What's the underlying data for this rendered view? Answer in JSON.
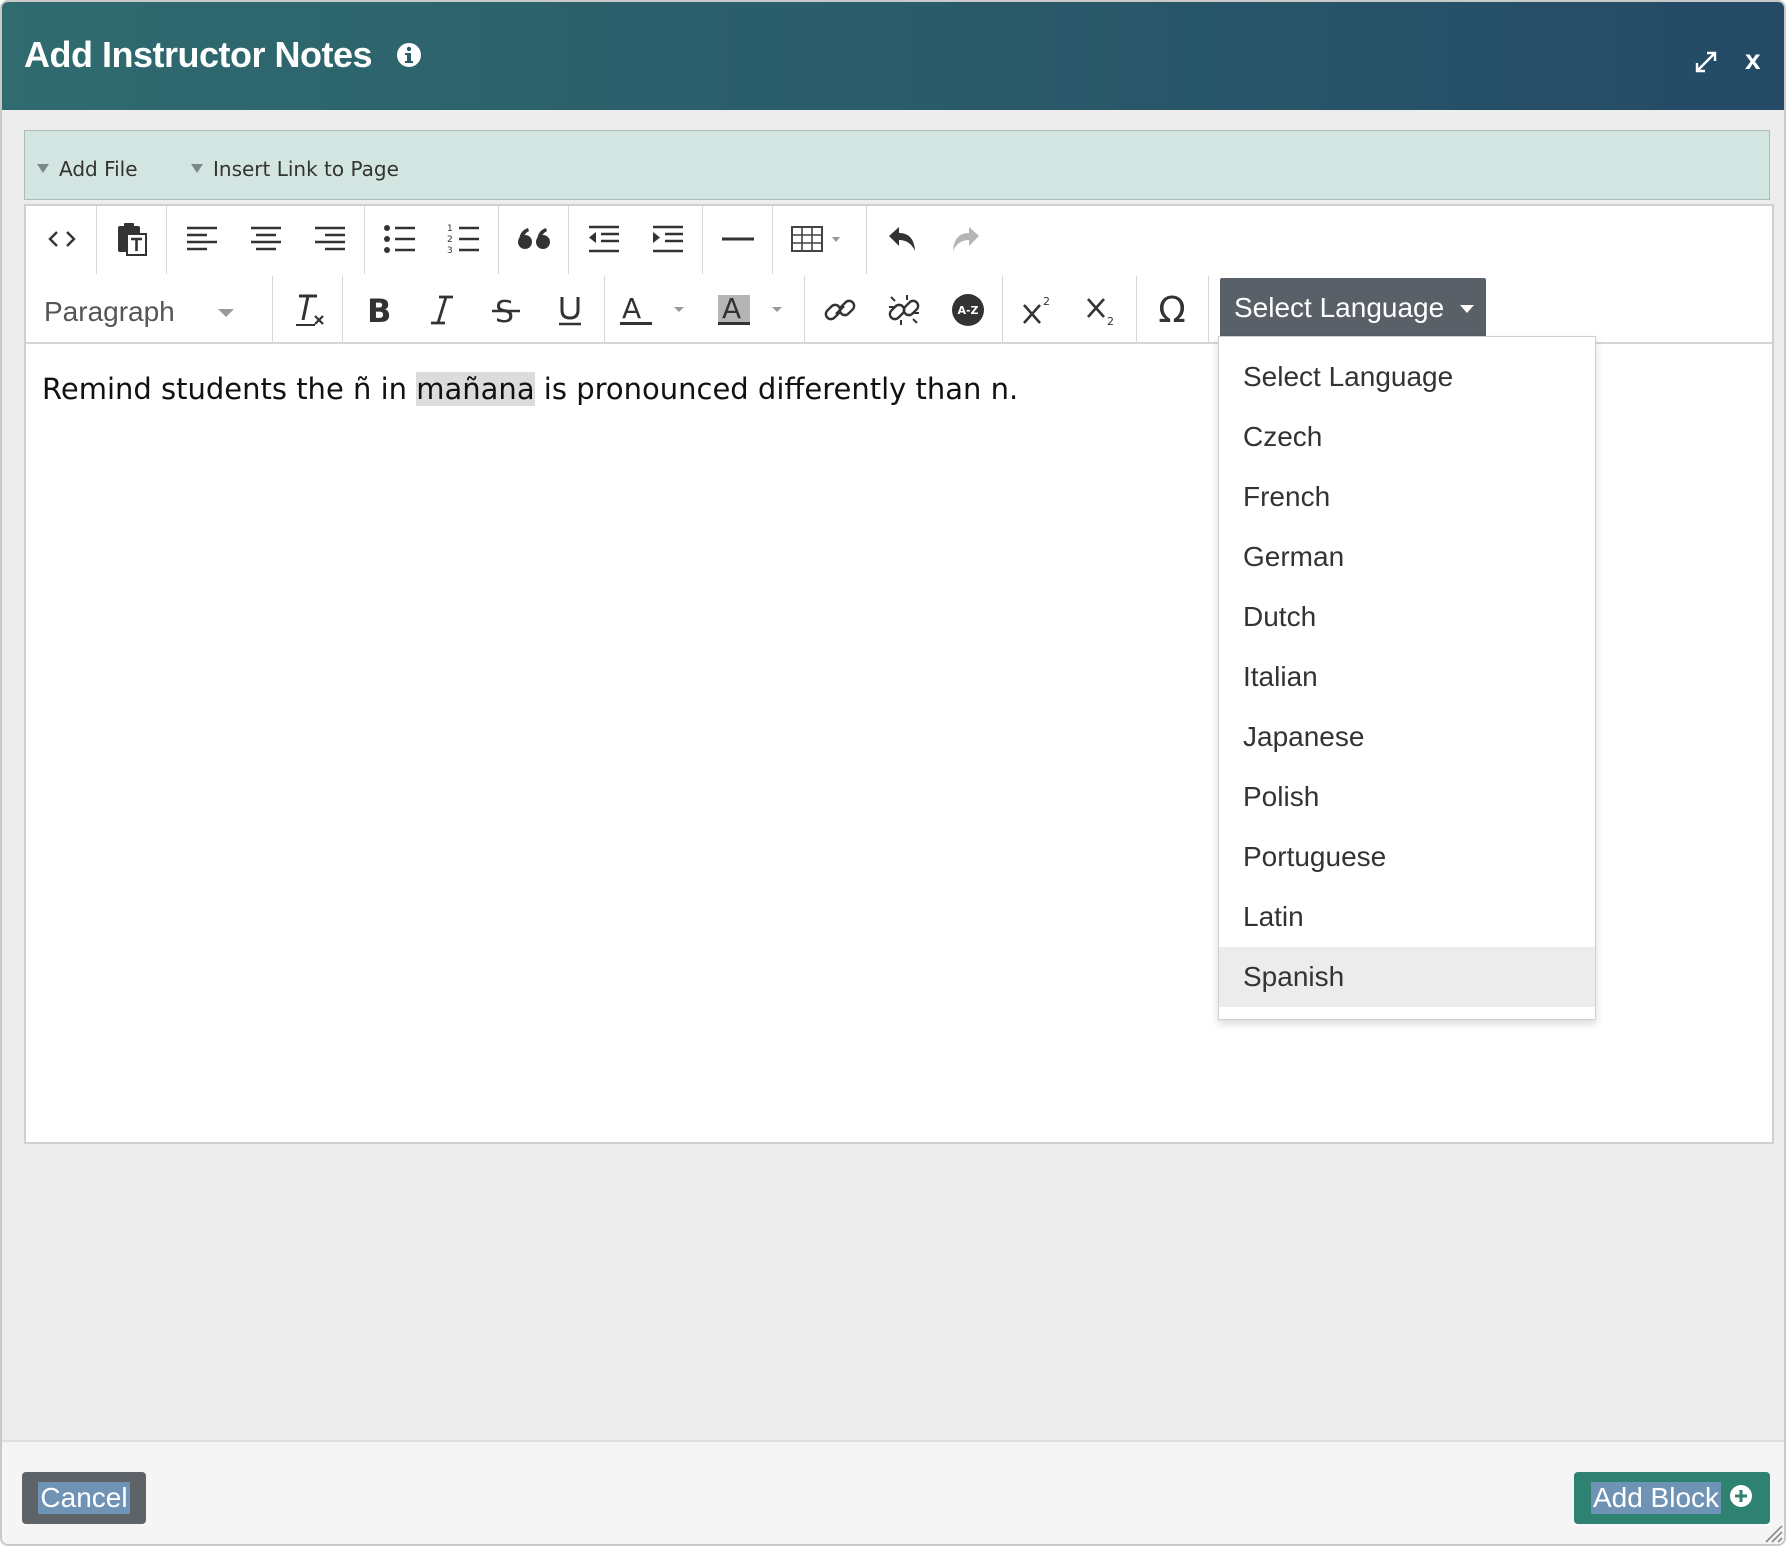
{
  "dialog": {
    "title": "Add Instructor Notes",
    "close_label": "x"
  },
  "insert_bar": {
    "add_file": "Add File",
    "insert_link": "Insert Link to Page"
  },
  "toolbar": {
    "row1_icons": [
      "source-code-icon",
      "paste-text-icon",
      "align-left-icon",
      "align-center-icon",
      "align-right-icon",
      "bulleted-list-icon",
      "numbered-list-icon",
      "blockquote-icon",
      "outdent-icon",
      "indent-icon",
      "horizontal-rule-icon",
      "table-icon",
      "undo-icon",
      "redo-icon"
    ],
    "row2_icons": [
      "clear-formatting-icon",
      "bold-icon",
      "italic-icon",
      "strikethrough-icon",
      "underline-icon",
      "text-color-icon",
      "background-color-icon",
      "link-icon",
      "unlink-icon",
      "glossary-az-icon",
      "superscript-icon",
      "subscript-icon",
      "special-character-icon"
    ],
    "paragraph_format": "Paragraph",
    "language_button": "Select Language",
    "glossary_badge": "A-Z"
  },
  "editor": {
    "text_before": "Remind students the ñ in ",
    "text_selected": "mañana",
    "text_after": " is pronounced differently than n."
  },
  "language_menu": {
    "options": [
      "Select Language",
      "Czech",
      "French",
      "German",
      "Dutch",
      "Italian",
      "Japanese",
      "Polish",
      "Portuguese",
      "Latin",
      "Spanish"
    ],
    "highlighted": "Spanish"
  },
  "footer": {
    "cancel_label": "Cancel",
    "add_block_label": "Add Block"
  },
  "colors": {
    "header_gradient_start": "#2f6b6f",
    "header_gradient_end": "#244a66",
    "insert_bar_bg": "#d3e5e1",
    "language_button_bg": "#5a6068",
    "add_block_bg": "#2f8272",
    "cancel_bg": "#5e6368"
  }
}
